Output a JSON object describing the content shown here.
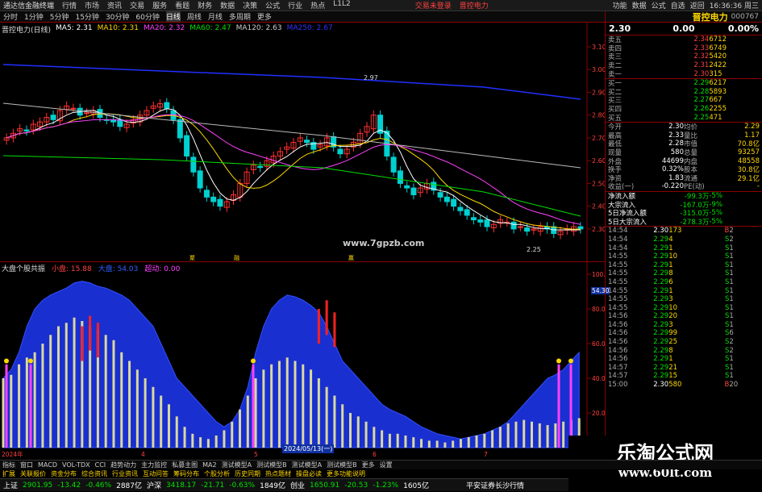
{
  "titlebar": {
    "app": "通达信金融终端",
    "menus": [
      "行情",
      "市场",
      "资讯",
      "交易",
      "服务",
      "看题",
      "财务",
      "数据",
      "决策",
      "公式",
      "行业",
      "热点",
      "L1L2"
    ],
    "warning1": "交易未登录",
    "warning2": "晋控电力",
    "right": [
      "功能",
      "数据",
      "公式",
      "自选",
      "返回"
    ],
    "time": "16:36:36 周三"
  },
  "timeframes": [
    "分时",
    "1分钟",
    "5分钟",
    "15分钟",
    "30分钟",
    "60分钟",
    "日线",
    "周线",
    "月线",
    "多周期",
    "更多"
  ],
  "main": {
    "stock_label": "晋控电力(日线)",
    "ma": [
      {
        "label": "MA5: 2.31",
        "color": "#ffffff"
      },
      {
        "label": "MA10: 2.31",
        "color": "#ffd700"
      },
      {
        "label": "MA20: 2.32",
        "color": "#ff40ff"
      },
      {
        "label": "MA60: 2.47",
        "color": "#00e000"
      },
      {
        "label": "MA120: 2.63",
        "color": "#cccccc"
      },
      {
        "label": "MA250: 2.67",
        "color": "#3030ff"
      }
    ],
    "price_axis": [
      "3.10",
      "3.00",
      "2.90",
      "2.80",
      "2.70",
      "2.60",
      "2.50",
      "2.40",
      "2.30"
    ],
    "high_label": "2.97",
    "low_label": "2.25",
    "watermark": "www.7gpzb.com",
    "markers": [
      "聚",
      "融",
      "赢"
    ]
  },
  "indicator": {
    "label": "大盘个股共振",
    "v1": "小盘: 15.88",
    "v2": "大盘: 54.03",
    "v3": "超动: 0.00",
    "axis": [
      "100.00",
      "80.00",
      "60.00",
      "40.00",
      "20.00"
    ],
    "cur": "54.30",
    "date_label": "2024/05/13(一)",
    "x_labels": [
      "2024年",
      "4",
      "5",
      "6",
      "7"
    ]
  },
  "quote": {
    "name": "晋控电力",
    "code": "000767",
    "price": "2.30",
    "change": "0.00",
    "pct": "0.00%",
    "sells": [
      {
        "l": "卖五",
        "p": "2.34",
        "v": "6712"
      },
      {
        "l": "卖四",
        "p": "2.33",
        "v": "6749"
      },
      {
        "l": "卖三",
        "p": "2.32",
        "v": "5420"
      },
      {
        "l": "卖二",
        "p": "2.31",
        "v": "2422"
      },
      {
        "l": "卖一",
        "p": "2.30",
        "v": "315"
      }
    ],
    "buys": [
      {
        "l": "买一",
        "p": "2.29",
        "v": "6217"
      },
      {
        "l": "买二",
        "p": "2.28",
        "v": "5893"
      },
      {
        "l": "买三",
        "p": "2.27",
        "v": "667"
      },
      {
        "l": "买四",
        "p": "2.26",
        "v": "2255"
      },
      {
        "l": "买五",
        "p": "2.25",
        "v": "471"
      }
    ],
    "stats": [
      {
        "a": "今开",
        "b": "2.30",
        "c": "均价",
        "d": "2.29"
      },
      {
        "a": "最高",
        "b": "2.33",
        "c": "量比",
        "d": "1.17"
      },
      {
        "a": "最低",
        "b": "2.28",
        "c": "市值",
        "d": "70.8亿"
      },
      {
        "a": "现量",
        "b": "580",
        "c": "总量",
        "d": "93257"
      },
      {
        "a": "外盘",
        "b": "44699",
        "c": "内盘",
        "d": "48558"
      },
      {
        "a": "换手",
        "b": "0.32%",
        "c": "股本",
        "d": "30.8亿"
      },
      {
        "a": "净资",
        "b": "1.83",
        "c": "流通",
        "d": "29.1亿"
      },
      {
        "a": "收益(一)",
        "b": "-0.220",
        "c": "PE(动)",
        "d": "-"
      }
    ],
    "flows": [
      {
        "l": "净流入额",
        "v": "-99.3万",
        "p": "-5%"
      },
      {
        "l": "大宗流入",
        "v": "-167.0万",
        "p": "-9%"
      },
      {
        "l": "5日净流入额",
        "v": "-315.0万",
        "p": "-5%"
      },
      {
        "l": "5日大宗流入",
        "v": "-278.3万",
        "p": "-5%"
      }
    ],
    "ticks": [
      {
        "t": "14:54",
        "p": "2.30",
        "v": "173",
        "f": "B",
        "n": "2"
      },
      {
        "t": "14:54",
        "p": "2.29",
        "v": "4",
        "f": "S",
        "n": "2"
      },
      {
        "t": "14:54",
        "p": "2.29",
        "v": "1",
        "f": "S",
        "n": "1"
      },
      {
        "t": "14:55",
        "p": "2.29",
        "v": "10",
        "f": "S",
        "n": "1"
      },
      {
        "t": "14:55",
        "p": "2.29",
        "v": "1",
        "f": "S",
        "n": "1"
      },
      {
        "t": "14:55",
        "p": "2.29",
        "v": "8",
        "f": "S",
        "n": "1"
      },
      {
        "t": "14:55",
        "p": "2.29",
        "v": "6",
        "f": "S",
        "n": "1"
      },
      {
        "t": "14:55",
        "p": "2.29",
        "v": "1",
        "f": "S",
        "n": "1"
      },
      {
        "t": "14:55",
        "p": "2.29",
        "v": "3",
        "f": "S",
        "n": "1"
      },
      {
        "t": "14:55",
        "p": "2.29",
        "v": "10",
        "f": "S",
        "n": "1"
      },
      {
        "t": "14:56",
        "p": "2.29",
        "v": "20",
        "f": "S",
        "n": "1"
      },
      {
        "t": "14:56",
        "p": "2.29",
        "v": "3",
        "f": "S",
        "n": "1"
      },
      {
        "t": "14:56",
        "p": "2.29",
        "v": "99",
        "f": "S",
        "n": "6"
      },
      {
        "t": "14:56",
        "p": "2.29",
        "v": "25",
        "f": "S",
        "n": "2"
      },
      {
        "t": "14:56",
        "p": "2.29",
        "v": "8",
        "f": "S",
        "n": "2"
      },
      {
        "t": "14:56",
        "p": "2.29",
        "v": "1",
        "f": "S",
        "n": "1"
      },
      {
        "t": "14:57",
        "p": "2.29",
        "v": "21",
        "f": "S",
        "n": "1"
      },
      {
        "t": "14:57",
        "p": "2.29",
        "v": "15",
        "f": "S",
        "n": "1"
      },
      {
        "t": "15:00",
        "p": "2.30",
        "v": "580",
        "f": "B",
        "n": "20"
      }
    ]
  },
  "tabs": [
    "指标",
    "窗口",
    "MACD",
    "VOL-TDX",
    "CCI",
    "趋势动力",
    "主力监控",
    "私募主图",
    "MA2",
    "测试模型A",
    "测试模型B",
    "测试模型A",
    "测试模型B",
    "更多",
    "设置"
  ],
  "tabs2": [
    "扩展",
    "关联报价",
    "资金分布",
    "综合资讯",
    "行业资讯",
    "互动问答",
    "筹码分布",
    "个股分析",
    "历史同期",
    "热点题材",
    "操盘必读",
    "更多功能说明"
  ],
  "status": {
    "sh_label": "上证",
    "sh": "2901.95",
    "sh_chg": "-13.42",
    "sh_pct": "-0.46%",
    "sh_amt": "2887亿",
    "sz_label": "沪深",
    "sz": "3418.17",
    "sz_chg": "-21.71",
    "sz_pct": "-0.63%",
    "sz_amt": "1849亿",
    "cy_label": "创业",
    "cy": "1650.91",
    "cy_chg": "-20.53",
    "cy_pct": "-1.23%",
    "cy_amt": "1605亿",
    "broker": "平安证券长沙行情"
  },
  "watermark2": {
    "t1": "乐淘公式网",
    "t2": "www.60lt.com"
  }
}
